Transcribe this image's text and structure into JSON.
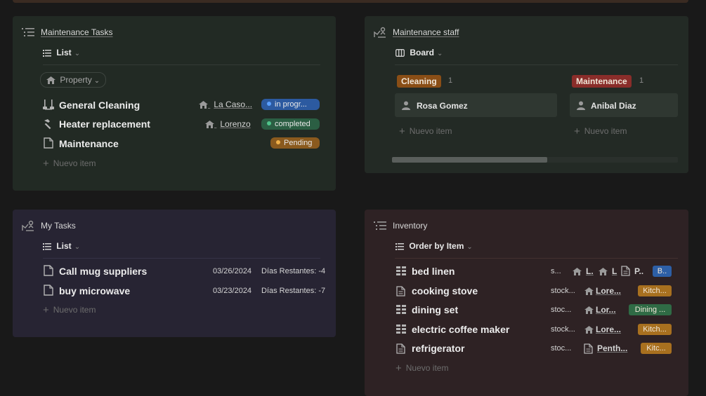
{
  "maintenance_tasks": {
    "title": "Maintenance Tasks",
    "view_label": "List",
    "filter_label": "Property",
    "rows": [
      {
        "title": "General Cleaning",
        "property": "La Caso...",
        "status": "in progr...",
        "status_color": "#2c5aa0",
        "dot_color": "#5aa0ff"
      },
      {
        "title": "Heater replacement",
        "property": "Lorenzo",
        "status": "completed",
        "status_color": "#2b5e43",
        "dot_color": "#4fc38a"
      },
      {
        "title": "Maintenance",
        "property": "",
        "status": "Pending",
        "status_color": "#8a5a1e",
        "dot_color": "#f0b048"
      }
    ],
    "new_item": "Nuevo item"
  },
  "maintenance_staff": {
    "title": "Maintenance staff",
    "view_label": "Board",
    "columns": [
      {
        "label": "Cleaning",
        "count": "1",
        "color": "#8a4e16",
        "card": "Rosa Gomez",
        "new_item": "Nuevo item"
      },
      {
        "label": "Maintenance",
        "count": "1",
        "color": "#8a2d2a",
        "card": "Anibal Diaz",
        "new_item": "Nuevo item"
      }
    ]
  },
  "my_tasks": {
    "title": "My Tasks",
    "view_label": "List",
    "rows": [
      {
        "title": "Call mug suppliers",
        "date": "03/26/2024",
        "days": "Días Restantes: -4"
      },
      {
        "title": "buy microwave",
        "date": "03/23/2024",
        "days": "Días Restantes: -7"
      }
    ],
    "new_item": "Nuevo item"
  },
  "inventory": {
    "title": "Inventory",
    "view_label": "Order by Item",
    "rows": [
      {
        "title": "bed linen",
        "icon": "grid-icon",
        "stock": "s...",
        "loc1": "L.",
        "loc2": "L",
        "loc3": "P..",
        "tag": "B..",
        "tag_color": "#2d5fa6"
      },
      {
        "title": "cooking stove",
        "icon": "page-icon",
        "stock": "stock...",
        "loc1": "Lore...",
        "tag": "Kitch...",
        "tag_color": "#a8701f"
      },
      {
        "title": "dining set",
        "icon": "grid-icon",
        "stock": "stoc...",
        "loc1": "Lor...",
        "tag": "Dining ...",
        "tag_color": "#2f6b45"
      },
      {
        "title": "electric coffee maker",
        "icon": "grid-icon",
        "stock": "stock...",
        "loc1": "Lore...",
        "tag": "Kitch...",
        "tag_color": "#a8701f"
      },
      {
        "title": "refrigerator",
        "icon": "page-icon",
        "stock": "stoc...",
        "loc1": "Penth...",
        "tag": "Kitc...",
        "tag_color": "#a8701f"
      }
    ],
    "new_item": "Nuevo item"
  }
}
